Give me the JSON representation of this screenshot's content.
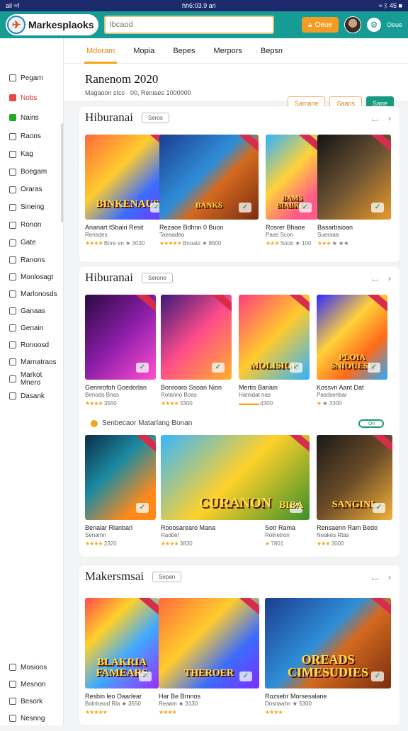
{
  "status": {
    "left": "ail ≈f",
    "center": "hh6:03.9 ari",
    "right": "≈ ᛒ 45 ■"
  },
  "topbar": {
    "logo_text": "Markesplaoks",
    "search_value": "Ibcaod",
    "orange_button": "Oeue",
    "avatar_label": "Oeue",
    "colors": {
      "teal": "#169b95",
      "accent": "#f39c24"
    }
  },
  "sidebar": {
    "items": [
      {
        "label": "Pegam",
        "icon": "home-icon"
      },
      {
        "label": "Nobs",
        "icon": "red-box-icon"
      },
      {
        "label": "Nains",
        "icon": "check-icon"
      },
      {
        "label": "Raons",
        "icon": "box-icon"
      },
      {
        "label": "Kag",
        "icon": "box-icon"
      },
      {
        "label": "Boegam",
        "icon": "box-icon"
      },
      {
        "label": "Oraras",
        "icon": "box-icon"
      },
      {
        "label": "Sineing",
        "icon": "box-icon"
      },
      {
        "label": "Ronon",
        "icon": "box-icon"
      },
      {
        "label": "Gate",
        "icon": "box-icon"
      },
      {
        "label": "Ranons",
        "icon": "box-icon"
      },
      {
        "label": "Monlosagt",
        "icon": "box-icon"
      },
      {
        "label": "Marlonosds",
        "icon": "box-icon"
      },
      {
        "label": "Ganaas",
        "icon": "box-icon"
      },
      {
        "label": "Genain",
        "icon": "box-icon"
      },
      {
        "label": "Ronoosd",
        "icon": "box-icon"
      },
      {
        "label": "Marnatraos",
        "icon": "box-icon"
      },
      {
        "label": "Markot Mnero",
        "icon": "box-icon"
      },
      {
        "label": "Dasank",
        "icon": "box-icon"
      }
    ],
    "bottom": [
      {
        "label": "Mosions"
      },
      {
        "label": "Mesnon"
      },
      {
        "label": "Besork"
      },
      {
        "label": "Nesnng"
      }
    ]
  },
  "tabs": [
    "Mdoram",
    "Mopia",
    "Bepes",
    "Merpors",
    "Bepsn"
  ],
  "header": {
    "title": "Ranenom 2020",
    "subtitle": "Magaoon stcs · 00, Reniaes 1000000",
    "buttons": [
      "Samane",
      "Saans",
      "Sane"
    ]
  },
  "sections": [
    {
      "title": "Hiburanai",
      "chip": "Seros",
      "cards": [
        {
          "art": "BINKENAUS",
          "name": "Ananart tSbairi Resit",
          "desc": "Rensdes",
          "stars": "★★★★",
          "meta": "Bnre en ★ 3030"
        },
        {
          "art": "BANKS",
          "name": "Rezaoe Bdhnn 0 Buon",
          "desc": "Taeaadeo",
          "stars": "★★★★★",
          "meta": "Bnoats ★ 8600"
        },
        {
          "art": "BAMS BIABKES",
          "name": "Rosrer Bhaoe",
          "desc": "Paas  Scon",
          "stars": "★★★",
          "meta": "Snob ★ 100"
        },
        {
          "art": "",
          "name": "Basarbsioan",
          "desc": "Sueraaa",
          "stars": "★★★",
          "meta": "★ ★★"
        }
      ]
    },
    {
      "title": "Hiburanai",
      "chip": "Serono",
      "cards": [
        {
          "art": "",
          "name": "Gennrofoh Goedorlan",
          "desc": "Benodo Bnas",
          "stars": "★★★★",
          "meta": "3560"
        },
        {
          "art": "",
          "name": "Bonroaro Ssoan Nion",
          "desc": "Rotanno Boas",
          "stars": "★★★★",
          "meta": "3300"
        },
        {
          "art": "MOLISIOU",
          "name": "Mertis Banain",
          "desc": "Hamidat nas",
          "stars": "▬▬▬▬",
          "meta": "4300"
        },
        {
          "art": "PLOIA SNIOUESE",
          "name": "Kossvn Aant Dat",
          "desc": "Pasdsenbar",
          "stars": "★",
          "meta": "★ 3300"
        }
      ]
    }
  ],
  "promo": {
    "title": "Senbecaor Matarlang Bonan",
    "toggle": "On",
    "cards": [
      {
        "art": "",
        "name": "Benalar Rlanbarl",
        "desc": "Senamn",
        "stars": "★★★★",
        "meta": "2320"
      },
      {
        "art": "CURANON",
        "name": "Rooosarearo Mana",
        "desc": "Raobel",
        "stars": "★★★★",
        "meta": "3830"
      },
      {
        "art": "BIBA",
        "name": "Sotr Rama",
        "desc": "Rolnetron",
        "stars": "★",
        "meta": "7801"
      },
      {
        "art": "SANGINL",
        "name": "Rensaenn Ram Bedo",
        "desc": "Neakes Rtas",
        "stars": "★★★",
        "meta": "3000"
      }
    ]
  },
  "section3": {
    "title": "Makersmsai",
    "chip": "Sepan",
    "cards": [
      {
        "art": "BLAKRIA FAMEARS",
        "name": "Resbin leo Oaarlear",
        "desc": "Bolnlosod Rla ★ 3550",
        "stars": "★★★★★",
        "meta": ""
      },
      {
        "art": "THEROER",
        "name": "Har Be Brnnos",
        "desc": "Reaam ★ 3130",
        "stars": "★★★★",
        "meta": ""
      },
      {
        "art": "OREADS CIMESUDIES",
        "name": "Rozsebr Morsesalane",
        "desc": "Dosnaahn ★ 5300",
        "stars": "★★★★",
        "meta": ""
      }
    ]
  }
}
